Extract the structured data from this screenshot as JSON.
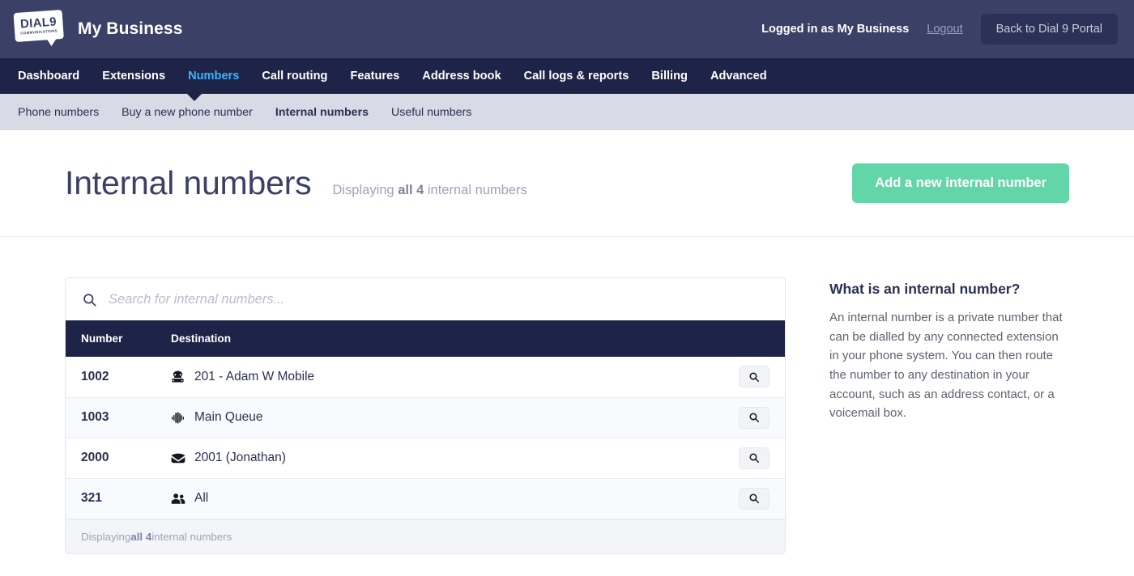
{
  "header": {
    "logo_main": "DIAL9",
    "logo_sub": "COMMUNICATIONS",
    "brand_name": "My Business",
    "logged_in_text": "Logged in as My Business",
    "logout_label": "Logout",
    "portal_button": "Back to Dial 9 Portal"
  },
  "main_nav": {
    "items": [
      {
        "label": "Dashboard",
        "active": false
      },
      {
        "label": "Extensions",
        "active": false
      },
      {
        "label": "Numbers",
        "active": true
      },
      {
        "label": "Call routing",
        "active": false
      },
      {
        "label": "Features",
        "active": false
      },
      {
        "label": "Address book",
        "active": false
      },
      {
        "label": "Call logs & reports",
        "active": false
      },
      {
        "label": "Billing",
        "active": false
      },
      {
        "label": "Advanced",
        "active": false
      }
    ]
  },
  "sub_nav": {
    "items": [
      {
        "label": "Phone numbers",
        "active": false
      },
      {
        "label": "Buy a new phone number",
        "active": false
      },
      {
        "label": "Internal numbers",
        "active": true
      },
      {
        "label": "Useful numbers",
        "active": false
      }
    ]
  },
  "page": {
    "title": "Internal numbers",
    "count_prefix": "Displaying ",
    "count_strong": "all 4",
    "count_suffix": " internal numbers",
    "add_button": "Add a new internal number"
  },
  "search": {
    "placeholder": "Search for internal numbers...",
    "value": "",
    "icon": "search-icon"
  },
  "table": {
    "columns": [
      "Number",
      "Destination",
      ""
    ],
    "rows": [
      {
        "number": "1002",
        "icon": "telephone-icon",
        "destination": "201 - Adam W Mobile",
        "action_icon": "search-icon"
      },
      {
        "number": "1003",
        "icon": "queue-icon",
        "destination": "Main Queue",
        "action_icon": "search-icon"
      },
      {
        "number": "2000",
        "icon": "voicemail-envelope-icon",
        "destination": "2001 (Jonathan)",
        "action_icon": "search-icon"
      },
      {
        "number": "321",
        "icon": "users-group-icon",
        "destination": "All",
        "action_icon": "search-icon"
      }
    ],
    "footer_prefix": "Displaying ",
    "footer_strong": "all 4",
    "footer_suffix": " internal numbers"
  },
  "sidebar": {
    "title": "What is an internal number?",
    "body": "An internal number is a private number that can be dialled by any connected extension in your phone system. You can then route the number to any destination in your account, such as an address contact, or a voicemail box."
  },
  "colors": {
    "header_bg": "#3a4066",
    "nav_bg": "#1e2447",
    "subnav_bg": "#d8dae6",
    "accent_blue": "#38b6ff",
    "accent_green": "#63d6a9",
    "text_dark": "#2b3051",
    "text_muted": "#9ea3bd"
  }
}
